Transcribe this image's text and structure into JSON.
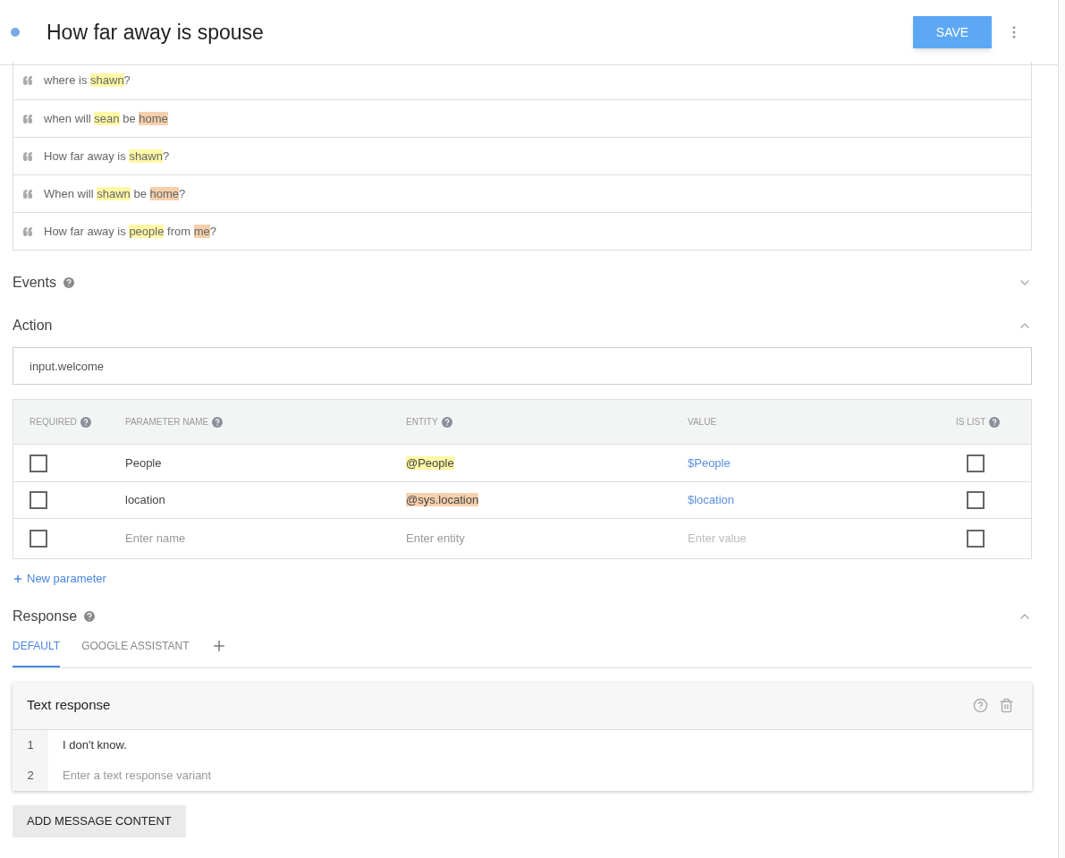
{
  "header": {
    "title": "How far away is spouse",
    "save_button": "SAVE"
  },
  "training_phrases": [
    [
      {
        "kind": "plain",
        "text": "where is "
      },
      {
        "kind": "entity",
        "text": "shawn",
        "color": "#fff9a6"
      },
      {
        "kind": "plain",
        "text": "?"
      }
    ],
    [
      {
        "kind": "plain",
        "text": "when will "
      },
      {
        "kind": "entity",
        "text": "sean",
        "color": "#fff9a6"
      },
      {
        "kind": "plain",
        "text": " be "
      },
      {
        "kind": "entity",
        "text": "home",
        "color": "#f6d0ad"
      }
    ],
    [
      {
        "kind": "plain",
        "text": "How far away is "
      },
      {
        "kind": "entity",
        "text": "shawn",
        "color": "#fff9a6"
      },
      {
        "kind": "plain",
        "text": "?"
      }
    ],
    [
      {
        "kind": "plain",
        "text": "When will "
      },
      {
        "kind": "entity",
        "text": "shawn",
        "color": "#fff9a6"
      },
      {
        "kind": "plain",
        "text": " be "
      },
      {
        "kind": "entity",
        "text": "home",
        "color": "#f6d0ad"
      },
      {
        "kind": "plain",
        "text": "?"
      }
    ],
    [
      {
        "kind": "plain",
        "text": "How far away is "
      },
      {
        "kind": "entity",
        "text": "people",
        "color": "#fff9a6"
      },
      {
        "kind": "plain",
        "text": " from "
      },
      {
        "kind": "entity",
        "text": "me",
        "color": "#f6d0ad"
      },
      {
        "kind": "plain",
        "text": "?"
      }
    ]
  ],
  "events": {
    "title": "Events",
    "expanded": false
  },
  "action": {
    "title": "Action",
    "expanded": true,
    "value": "input.welcome"
  },
  "parameters": {
    "columns": [
      {
        "label": "REQUIRED",
        "help": true
      },
      {
        "label": "PARAMETER NAME",
        "help": true
      },
      {
        "label": "ENTITY",
        "help": true
      },
      {
        "label": "VALUE",
        "help": false
      },
      {
        "label": "IS LIST",
        "help": true
      }
    ],
    "rows": [
      {
        "required": false,
        "name": "People",
        "entity": "@People",
        "color": "#fff9a6",
        "value": "$People",
        "is_list": false
      },
      {
        "required": false,
        "name": "location",
        "entity": "@sys.location",
        "color": "#f6d0ad",
        "value": "$location",
        "is_list": false
      },
      {
        "required": false,
        "name_placeholder": "Enter name",
        "entity_placeholder": "Enter entity",
        "value_placeholder": "Enter value",
        "is_list": false
      }
    ],
    "new_parameter": "New parameter"
  },
  "response": {
    "title": "Response",
    "expanded": true,
    "tabs": [
      {
        "label": "DEFAULT",
        "selected": true
      },
      {
        "label": "GOOGLE ASSISTANT",
        "selected": false
      }
    ],
    "card": {
      "title": "Text response",
      "lines": [
        {
          "number": "1",
          "value": "I don't know."
        },
        {
          "number": "2",
          "placeholder": "Enter a text response variant"
        }
      ]
    },
    "add_button": "ADD MESSAGE CONTENT"
  }
}
